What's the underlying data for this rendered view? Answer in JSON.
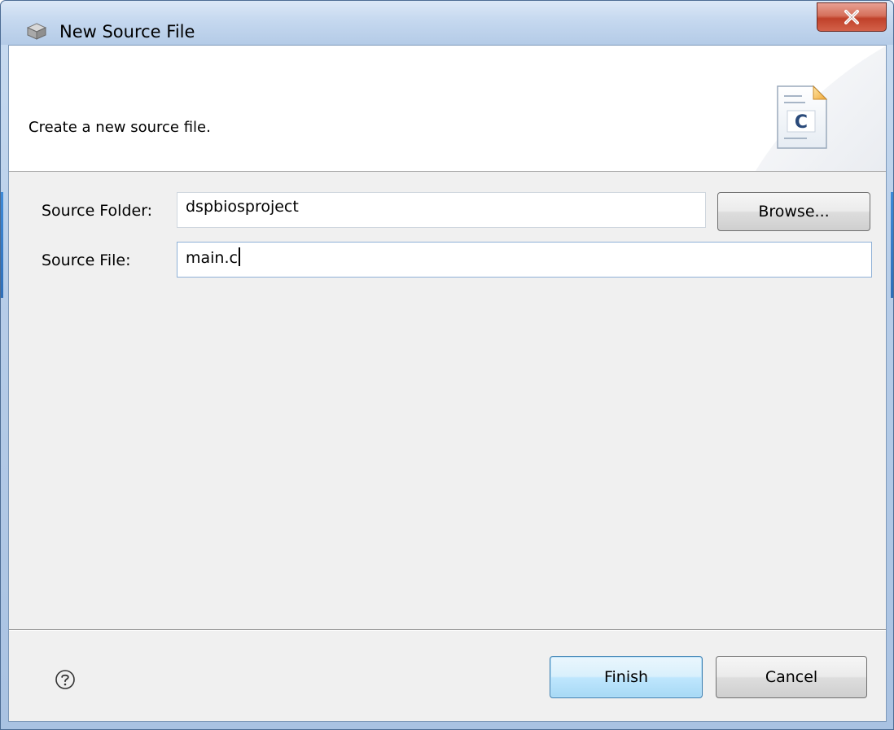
{
  "window": {
    "title": "New Source File",
    "close_label": "X"
  },
  "banner": {
    "message": "Create a new source file.",
    "file_icon_letter": "C"
  },
  "form": {
    "source_folder": {
      "label": "Source Folder:",
      "value": "dspbiosproject"
    },
    "source_file": {
      "label": "Source File:",
      "value": "main.c"
    },
    "browse_label": "Browse..."
  },
  "footer": {
    "finish_label": "Finish",
    "cancel_label": "Cancel"
  },
  "icons": {
    "title": "app-cube-icon",
    "close": "close-icon",
    "banner": "c-source-file-icon",
    "help": "help-icon"
  },
  "colors": {
    "titlebar": "#c5d8ef",
    "close_button": "#c0412a",
    "dialog_background": "#f0f0f0",
    "default_button": "#bee6fd"
  }
}
